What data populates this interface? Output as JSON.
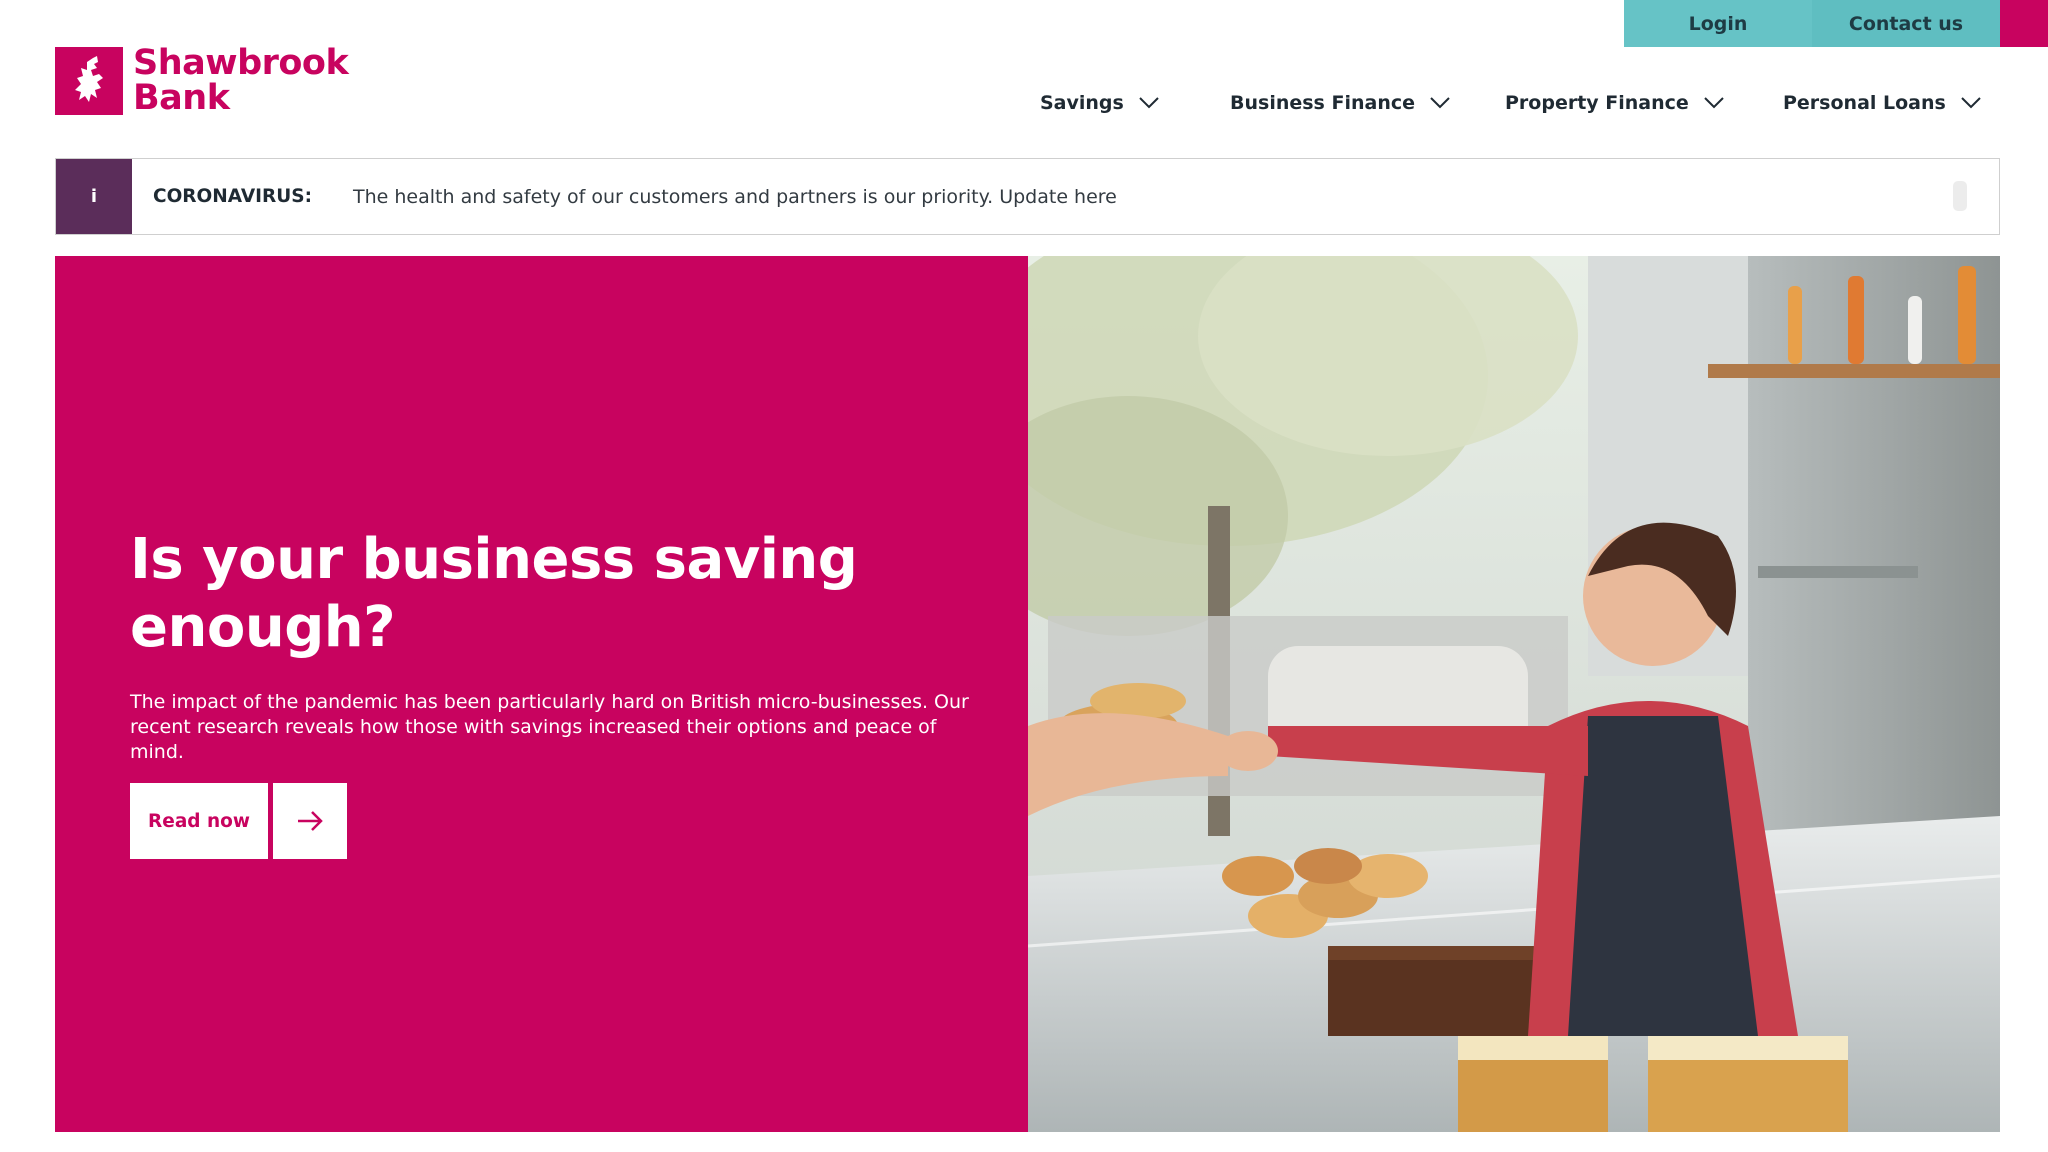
{
  "brand": {
    "line1": "Shawbrook",
    "line2": "Bank",
    "color": "#c8035f",
    "accent": "#c8035f",
    "banner_info": "#5b2d5a",
    "teal": "#66c3c6"
  },
  "utility": {
    "login": "Login",
    "contact": "Contact us"
  },
  "nav": {
    "items": [
      {
        "label": "Savings",
        "icon": "chevron-down-icon"
      },
      {
        "label": "Business Finance",
        "icon": "chevron-down-icon"
      },
      {
        "label": "Property Finance",
        "icon": "chevron-down-icon"
      },
      {
        "label": "Personal Loans",
        "icon": "chevron-down-icon"
      }
    ]
  },
  "banner": {
    "info_glyph": "i",
    "label": "CORONAVIRUS:",
    "message": "The health and safety of our customers and partners is our priority. Update here"
  },
  "hero": {
    "title": "Is your business saving enough?",
    "description": "The impact of the pandemic has been particularly hard on British micro-businesses. Our recent research reveals how those with savings increased their options and peace of mind.",
    "cta_label": "Read now",
    "cta_icon": "arrow-right-icon",
    "image": "bakery-counter-photo"
  }
}
